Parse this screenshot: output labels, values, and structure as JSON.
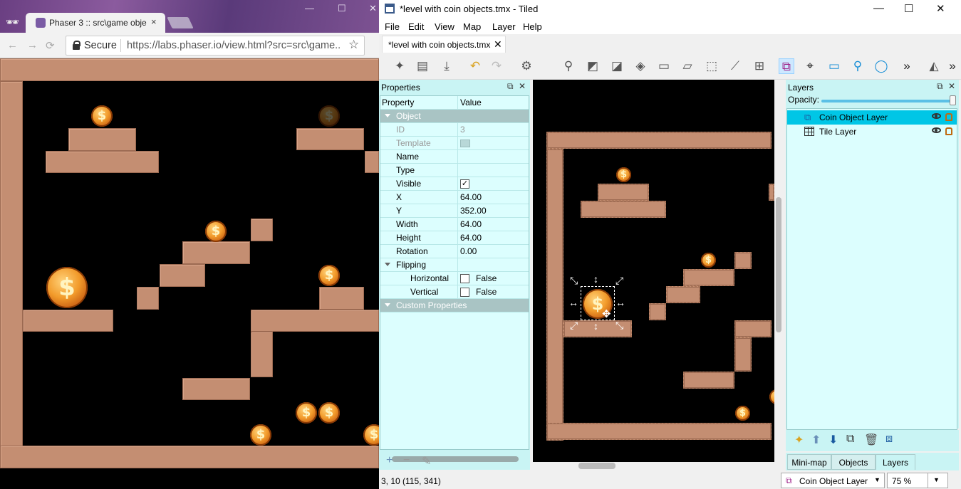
{
  "browser": {
    "tab_title": "Phaser 3 :: src\\game obje",
    "tab_close": "×",
    "secure_label": "Secure",
    "url": "https://labs.phaser.io/view.html?src=src\\game...",
    "win_min": "—",
    "win_max": "☐",
    "win_close": "✕"
  },
  "tiled": {
    "window_title": "*level with coin objects.tmx - Tiled",
    "win_min": "—",
    "win_max": "☐",
    "win_close": "✕",
    "menu": [
      "File",
      "Edit",
      "View",
      "Map",
      "Layer",
      "Help"
    ],
    "doc_tab": "*level with coin objects.tmx",
    "doc_tab_close": "✕",
    "properties": {
      "title": "Properties",
      "col_property": "Property",
      "col_value": "Value",
      "group_object": "Object",
      "rows": [
        {
          "key": "ID",
          "value": "3"
        },
        {
          "key": "Template",
          "value": ""
        },
        {
          "key": "Name",
          "value": ""
        },
        {
          "key": "Type",
          "value": ""
        },
        {
          "key": "Visible",
          "value": "✓"
        },
        {
          "key": "X",
          "value": "64.00"
        },
        {
          "key": "Y",
          "value": "352.00"
        },
        {
          "key": "Width",
          "value": "64.00"
        },
        {
          "key": "Height",
          "value": "64.00"
        },
        {
          "key": "Rotation",
          "value": "0.00"
        }
      ],
      "group_flipping": "Flipping",
      "flip_horizontal_label": "Horizontal",
      "flip_horizontal_value": "False",
      "flip_vertical_label": "Vertical",
      "flip_vertical_value": "False",
      "group_custom": "Custom Properties",
      "add_icon": "+",
      "remove_icon": "−",
      "edit_icon": "✎"
    },
    "layers": {
      "title": "Layers",
      "opacity_label": "Opacity:",
      "items": [
        {
          "name": "Coin Object Layer",
          "selected": true
        },
        {
          "name": "Tile Layer",
          "selected": false
        }
      ]
    },
    "bottom_tabs": [
      "Mini-map",
      "Objects",
      "Layers"
    ],
    "status_text": "3, 10 (115, 341)",
    "current_layer": "Coin Object Layer",
    "zoom": "75 %",
    "coin_glyph": "$",
    "colors": {
      "selection": "#00c6e6",
      "panel": "#c9f4f4",
      "tile": "#c48e72"
    }
  }
}
